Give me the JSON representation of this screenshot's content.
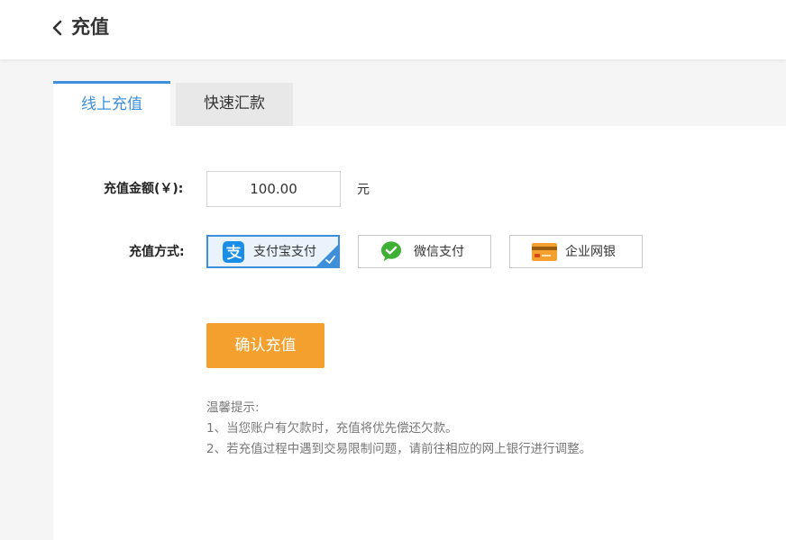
{
  "header": {
    "title": "充值",
    "back_icon": "chevron-left-icon"
  },
  "tabs": [
    {
      "label": "线上充值",
      "active": true
    },
    {
      "label": "快速汇款",
      "active": false
    }
  ],
  "form": {
    "amount_label": "充值金额(￥):",
    "amount_value": "100.00",
    "amount_unit": "元",
    "method_label": "充值方式:",
    "methods": [
      {
        "label": "支付宝支付",
        "icon": "alipay-icon",
        "selected": true
      },
      {
        "label": "微信支付",
        "icon": "wechat-icon",
        "selected": false
      },
      {
        "label": "企业网银",
        "icon": "bank-card-icon",
        "selected": false
      }
    ],
    "confirm_label": "确认充值"
  },
  "tips": {
    "title": "温馨提示:",
    "items": [
      "1、当您账户有欠款时，充值将优先偿还欠款。",
      "2、若充值过程中遇到交易限制问题，请前往相应的网上银行进行调整。"
    ]
  },
  "colors": {
    "accent": "#3d8fd9",
    "confirm": "#f3a02f",
    "alipay": "#1a8ee6",
    "wechat": "#3eb135",
    "bank": "#f3a02f"
  }
}
